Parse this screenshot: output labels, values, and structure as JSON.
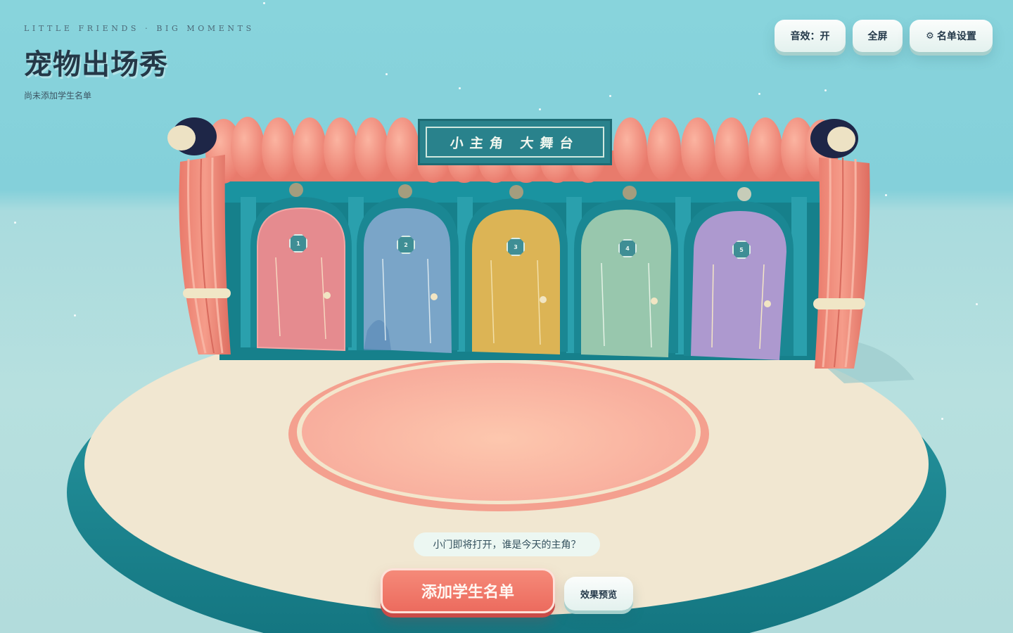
{
  "header": {
    "tagline": "LITTLE FRIENDS · BIG MOMENTS",
    "title": "宠物出场秀",
    "subtitle": "尚未添加学生名单"
  },
  "toolbar": {
    "sound_label": "音效：开",
    "fullscreen_label": "全屏",
    "roster_settings_label": "名单设置",
    "roster_settings_icon": "gear-icon"
  },
  "stage": {
    "sign_text": "小主角 大舞台",
    "doors": [
      {
        "number": "1",
        "color": "#e58b8f"
      },
      {
        "number": "2",
        "color": "#7aa5c8"
      },
      {
        "number": "3",
        "color": "#dcb455"
      },
      {
        "number": "4",
        "color": "#98c7ad"
      },
      {
        "number": "5",
        "color": "#ad99cf"
      }
    ]
  },
  "hint_text": "小门即将打开，谁是今天的主角？",
  "actions": {
    "add_roster_label": "添加学生名单",
    "preview_label": "效果预览"
  },
  "colors": {
    "accent": "#ef7364",
    "stage_teal": "#1b8a95",
    "platform": "#f2e8d2",
    "circle": "#f9b09d"
  }
}
